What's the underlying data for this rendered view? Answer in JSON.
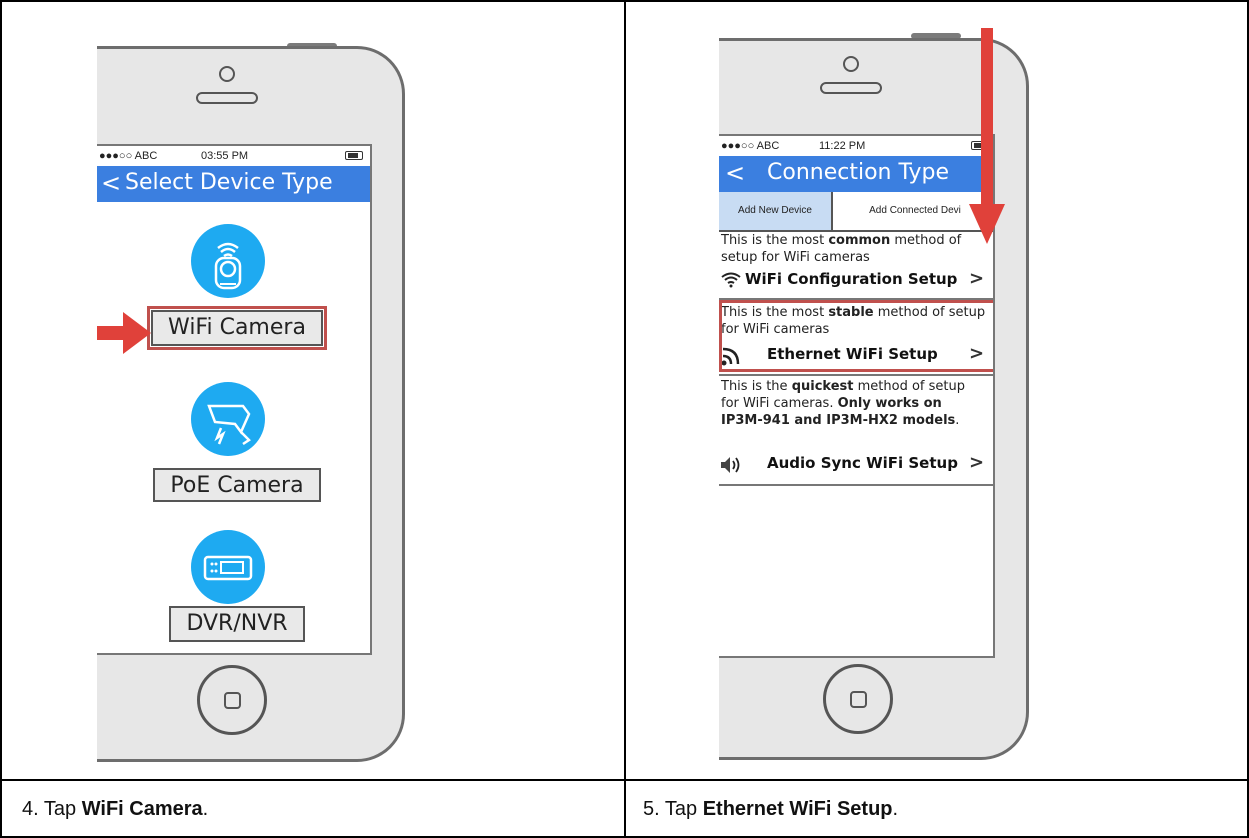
{
  "left": {
    "status": {
      "carrier": "●●●○○ ABC",
      "time": "03:55 PM"
    },
    "title": "Select Device Type",
    "back_glyph": "<",
    "devices": [
      {
        "label": "WiFi Camera",
        "icon": "wifi-camera-icon"
      },
      {
        "label": "PoE Camera",
        "icon": "poe-camera-icon"
      },
      {
        "label": "DVR/NVR",
        "icon": "dvr-icon"
      }
    ],
    "caption": {
      "prefix": "4.  Tap ",
      "bold": "WiFi Camera",
      "suffix": "."
    }
  },
  "right": {
    "status": {
      "carrier": "●●●○○ ABC",
      "time": "11:22 PM"
    },
    "title": "Connection Type",
    "back_glyph": "<",
    "tabs": [
      "Add New Device",
      "Add Connected Devi"
    ],
    "options": [
      {
        "desc_pre": "This is the most ",
        "desc_bold": "common",
        "desc_post": " method of setup for WiFi cameras",
        "label": "WiFi Configuration Setup",
        "icon": "wifi-icon"
      },
      {
        "desc_pre": "This is the most ",
        "desc_bold": "stable",
        "desc_post": " method of setup for WiFi cameras",
        "label": "Ethernet WiFi Setup",
        "icon": "ethernet-icon"
      },
      {
        "desc_pre": "This is the ",
        "desc_bold": "quickest",
        "desc_post": " method of setup for WiFi cameras. ",
        "desc_bold2": "Only works on IP3M-941 and IP3M-HX2 models",
        "desc_post2": ".",
        "label": "Audio Sync WiFi Setup",
        "icon": "speaker-icon"
      }
    ],
    "chevron": ">",
    "caption": {
      "prefix": "5.  Tap ",
      "bold": "Ethernet WiFi Setup",
      "suffix": "."
    }
  },
  "colors": {
    "title_bar": "#3b7fe0",
    "device_circle": "#1eaaf1",
    "highlight": "#c0504d",
    "arrow": "#e0413a",
    "tab_active": "#c8dcf3"
  }
}
